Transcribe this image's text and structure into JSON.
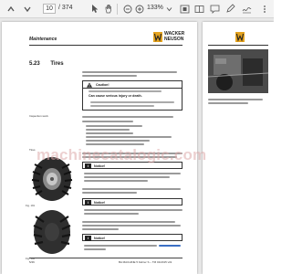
{
  "toolbar": {
    "current_page": "10",
    "page_total": "/ 374",
    "zoom": "133%"
  },
  "page": {
    "header_title": "Maintenance",
    "section_number": "5.23",
    "section_title": "Tires",
    "subheading": "Inspection work",
    "figure_label": "Tires",
    "fig1": "Fig. 191",
    "fig2": "Fig. 192",
    "caution_label": "Caution!",
    "caution_text": "Can cause serious injury or death.",
    "notice_label_1": "Notice!",
    "notice_label_2": "Notice!",
    "notice_label_3": "Notice!",
    "footer_left": "5/46",
    "footer_right": "BA MACHINE 5 Fahrer S – TM 01/2015 v01"
  },
  "logo": {
    "line1": "WACKER",
    "line2": "NEUSON",
    "brand_color": "#e5a31f"
  },
  "watermark": "machinecatalogic.com"
}
